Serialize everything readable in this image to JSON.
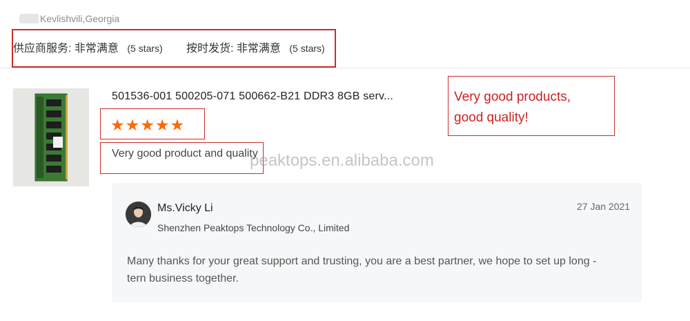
{
  "reviewer": {
    "location": "Kevlishvili,Georgia"
  },
  "ratings": {
    "service_label": "供应商服务:",
    "service_value": "非常满意",
    "service_stars": "(5 stars)",
    "delivery_label": "按时发货:",
    "delivery_value": "非常满意",
    "delivery_stars": "(5 stars)"
  },
  "product": {
    "title": "501536-001 500205-071 500662-B21 DDR3 8GB serv...",
    "rating": 5,
    "star_glyph": "★",
    "comment": "Very good product and quality"
  },
  "annotation": {
    "line1": "Very good products,",
    "line2": "good quality!"
  },
  "watermark": "peaktops.en.alibaba.com",
  "reply": {
    "name": "Ms.Vicky Li",
    "company": "Shenzhen Peaktops Technology Co., Limited",
    "date": "27 Jan 2021",
    "text": "Many thanks for your great support and trusting, you are a best partner, we hope to set up long -tern business together."
  },
  "colors": {
    "star": "#ff6a00",
    "annotation_red": "#cc2b2b",
    "reply_bg": "#f6f7f9"
  }
}
